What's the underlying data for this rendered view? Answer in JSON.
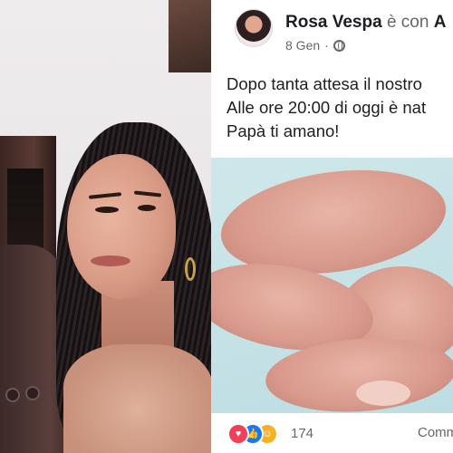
{
  "post": {
    "author": "Rosa Vespa",
    "with_label": "è con",
    "tagged_initial": "A",
    "date": "8 Gen",
    "separator": "·",
    "privacy_icon": "globe-icon",
    "text_lines": [
      "Dopo tanta attesa il nostro",
      "Alle ore 20:00 di oggi è nat",
      "Papà ti amano!"
    ]
  },
  "reactions": {
    "icons": [
      "love-icon",
      "like-icon",
      "care-icon"
    ],
    "count": "174",
    "comments_label": "Comm"
  },
  "colors": {
    "text": "#1c1e21",
    "secondary": "#65676b",
    "like": "#1877f2",
    "love": "#f33e58",
    "care": "#f7b125"
  }
}
